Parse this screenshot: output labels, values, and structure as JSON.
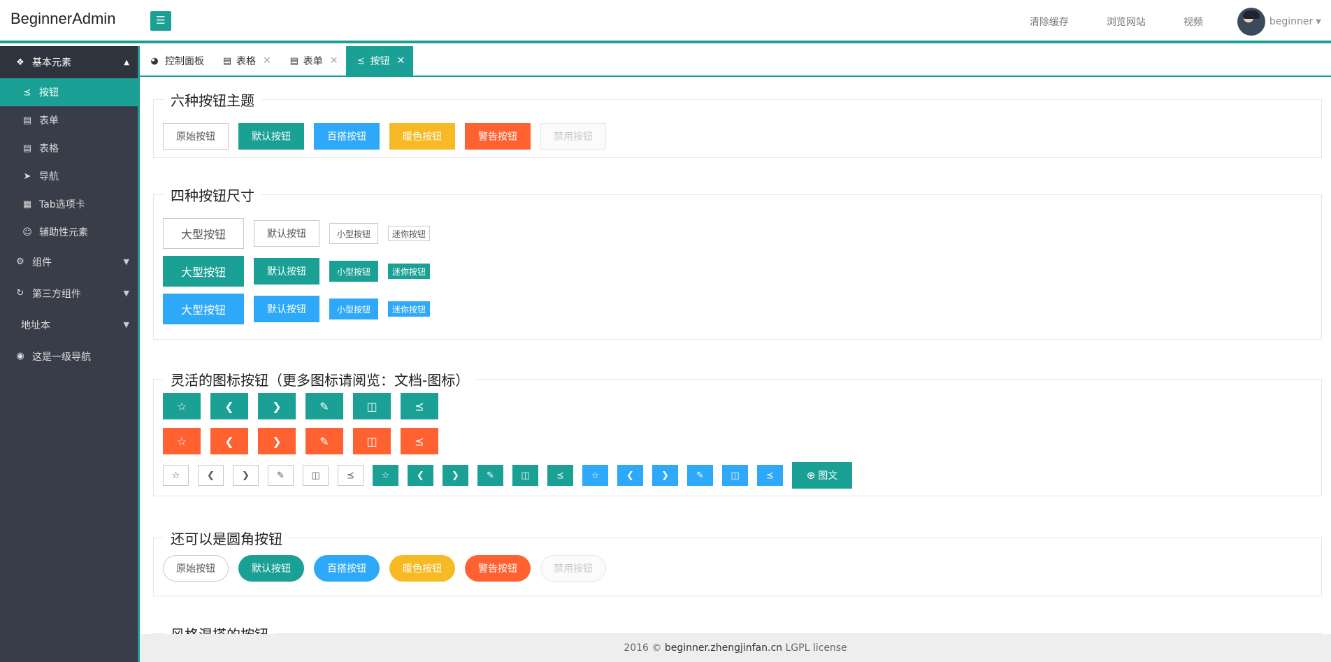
{
  "header": {
    "logo": "BeginnerAdmin",
    "menu_icon": "hamburger-icon",
    "links": [
      "清除缓存",
      "浏览网站",
      "视频"
    ],
    "username": "beginner"
  },
  "sidebar": {
    "group_title": "基本元素",
    "items": [
      {
        "label": "按钮",
        "icon": "share-icon",
        "active": true
      },
      {
        "label": "表单",
        "icon": "file-icon"
      },
      {
        "label": "表格",
        "icon": "file-icon"
      },
      {
        "label": "导航",
        "icon": "send-icon"
      },
      {
        "label": "Tab选项卡",
        "icon": "calendar-icon"
      },
      {
        "label": "辅助性元素",
        "icon": "smile-icon"
      }
    ],
    "groups": [
      {
        "label": "组件",
        "icon": "gears-icon"
      },
      {
        "label": "第三方组件",
        "icon": "refresh-icon"
      },
      {
        "label": "地址本",
        "icon": ""
      },
      {
        "label": "这是一级导航",
        "icon": "dot-circle-icon"
      }
    ]
  },
  "tabs": [
    {
      "label": "控制面板",
      "icon": "dashboard-icon",
      "closable": false
    },
    {
      "label": "表格",
      "icon": "file-icon",
      "closable": true
    },
    {
      "label": "表单",
      "icon": "file-icon",
      "closable": true
    },
    {
      "label": "按钮",
      "icon": "share-icon",
      "closable": true,
      "active": true
    }
  ],
  "sections": {
    "themes": {
      "title": "六种按钮主题",
      "buttons": [
        "原始按钮",
        "默认按钮",
        "百搭按钮",
        "暖色按钮",
        "警告按钮",
        "禁用按钮"
      ]
    },
    "sizes": {
      "title": "四种按钮尺寸",
      "buttons": [
        "大型按钮",
        "默认按钮",
        "小型按钮",
        "迷你按钮"
      ]
    },
    "icons": {
      "title": "灵活的图标按钮（更多图标请阅览：文档-图标）",
      "icon_text_button": "图文"
    },
    "rounded": {
      "title": "还可以是圆角按钮",
      "buttons": [
        "原始按钮",
        "默认按钮",
        "百搭按钮",
        "暖色按钮",
        "警告按钮",
        "禁用按钮"
      ]
    },
    "mixed": {
      "title": "风格混搭的按钮"
    }
  },
  "footer": {
    "year": "2016 ©",
    "site": "beginner.zhengjinfan.cn",
    "license": "LGPL license"
  },
  "colors": {
    "accent": "#1aa094",
    "normal": "#2ea8f8",
    "warm": "#f7b924",
    "danger": "#ff6131",
    "sidebar": "#393d49"
  }
}
